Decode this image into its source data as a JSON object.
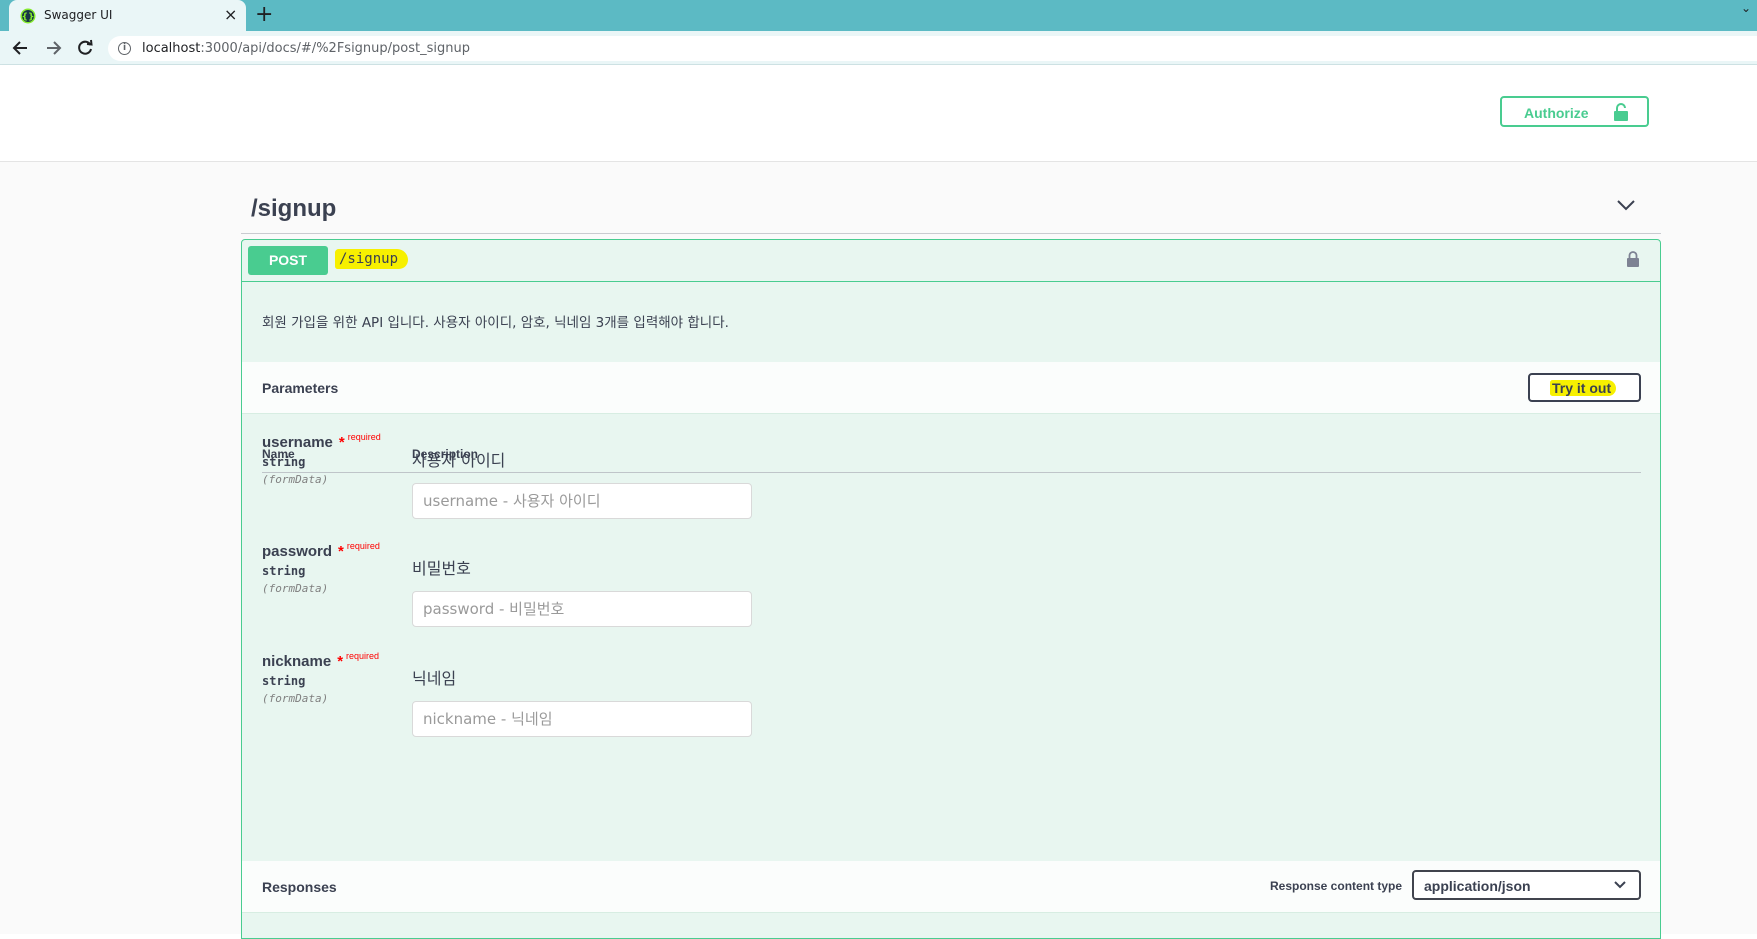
{
  "browser": {
    "tab_title": "Swagger UI",
    "tab_close": "×",
    "new_tab": "+",
    "url_host": "localhost",
    "url_rest": ":3000/api/docs/#/%2Fsignup/post_signup",
    "tabbar_chevron": "⌄"
  },
  "header": {
    "authorize_label": "Authorize"
  },
  "section": {
    "title": "/signup"
  },
  "operation": {
    "method": "POST",
    "path": "/signup",
    "description": "회원 가입을 위한 API 입니다. 사용자 아이디, 암호, 닉네임 3개를 입력해야 합니다.",
    "parameters_title": "Parameters",
    "try_it_out_label": "Try it out",
    "columns": {
      "name": "Name",
      "description": "Description"
    },
    "parameters": [
      {
        "name": "username",
        "star": "*",
        "required": "required",
        "type": "string",
        "in": "(formData)",
        "description": "사용자 아이디",
        "placeholder": "username - 사용자 아이디"
      },
      {
        "name": "password",
        "star": "*",
        "required": "required",
        "type": "string",
        "in": "(formData)",
        "description": "비밀번호",
        "placeholder": "password - 비밀번호"
      },
      {
        "name": "nickname",
        "star": "*",
        "required": "required",
        "type": "string",
        "in": "(formData)",
        "description": "닉네임",
        "placeholder": "nickname - 닉네임"
      }
    ],
    "responses_title": "Responses",
    "response_content_type_label": "Response content type",
    "response_content_type_value": "application/json"
  },
  "colors": {
    "post_green": "#49cc90",
    "op_background": "#e8f6f0",
    "highlight_yellow": "#f7f000",
    "browser_tabbar": "#5cbac4",
    "required_red": "#ff0000"
  },
  "icons": [
    "swagger-favicon-icon",
    "back-arrow-icon",
    "forward-arrow-icon",
    "reload-icon",
    "info-icon",
    "translate-icon",
    "unlock-icon",
    "chevron-down-icon",
    "lock-icon"
  ]
}
